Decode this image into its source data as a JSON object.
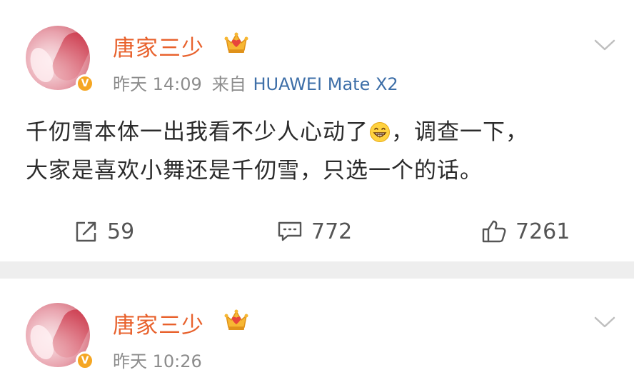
{
  "posts": [
    {
      "author": "唐家三少",
      "time": "昨天 14:09",
      "from_label": "来自",
      "source": "HUAWEI Mate X2",
      "content_lines": [
        {
          "before": "千仞雪本体一出我看不少人心动了",
          "after": "，调查一下，"
        },
        {
          "text": "大家是喜欢小舞还是千仞雪，只选一个的话。"
        }
      ],
      "actions": {
        "repost": "59",
        "comment": "772",
        "like": "7261"
      }
    },
    {
      "author": "唐家三少",
      "time": "昨天 10:26"
    }
  ],
  "icons": {
    "verified": "V",
    "vip": "crown-icon",
    "menu": "chevron-down-icon",
    "emoji": "grin-emoji",
    "repost": "repost-icon",
    "comment": "comment-icon",
    "like": "thumbs-up-icon"
  },
  "colors": {
    "name": "#e8612c",
    "meta": "#8c8c8c",
    "source": "#3e6fa8",
    "text": "#2b2b2b",
    "separator": "#eeeeee",
    "verified": "#f5a623"
  }
}
